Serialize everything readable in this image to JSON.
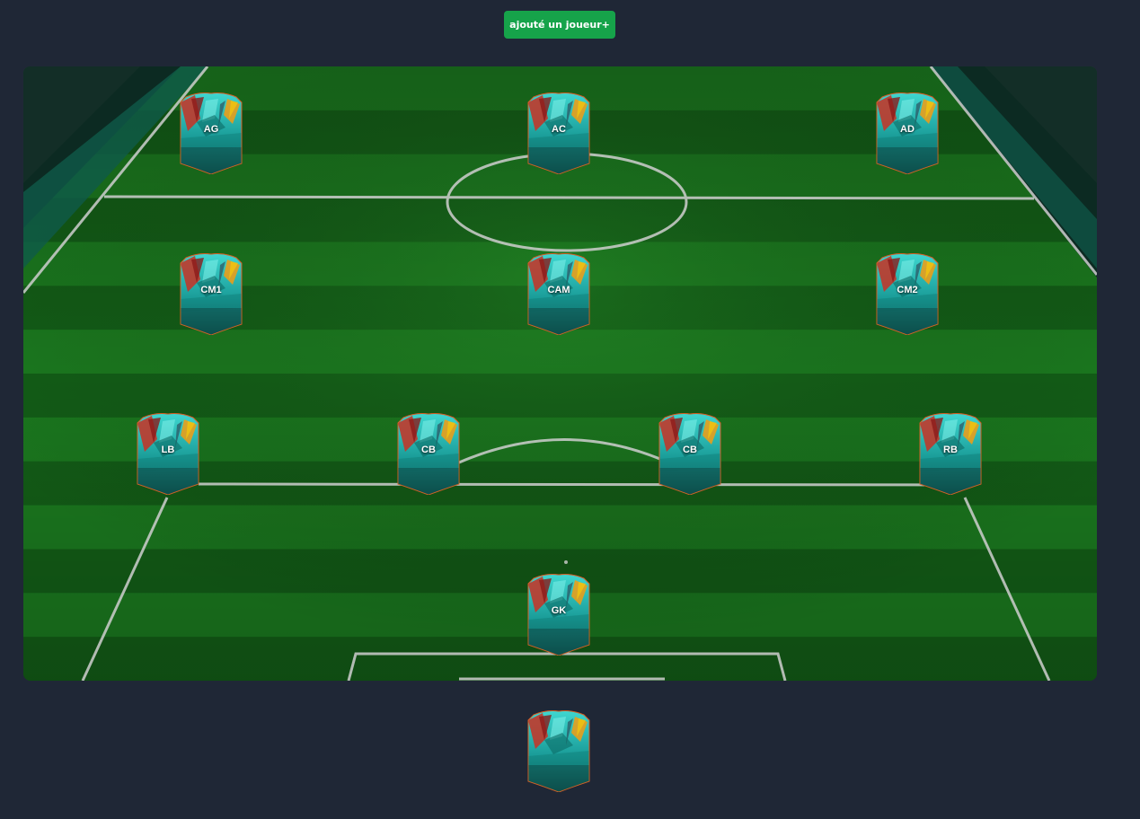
{
  "toolbar": {
    "add_player_label": "ajouté un joueur+"
  },
  "colors": {
    "page_bg": "#1f2736",
    "button_bg": "#16a34a",
    "pitch_grass_light": "#1b7a1f",
    "pitch_grass_dark": "#135e17",
    "card_teal": "#1fa7a3"
  },
  "formation": {
    "forwards": [
      {
        "pos": "AG"
      },
      {
        "pos": "AC"
      },
      {
        "pos": "AD"
      }
    ],
    "midfielders": [
      {
        "pos": "CM1"
      },
      {
        "pos": "CAM"
      },
      {
        "pos": "CM2"
      }
    ],
    "defenders": [
      {
        "pos": "LB"
      },
      {
        "pos": "CB"
      },
      {
        "pos": "CB"
      },
      {
        "pos": "RB"
      }
    ],
    "goalkeeper": {
      "pos": "GK"
    }
  },
  "bench": [
    {
      "pos": ""
    }
  ]
}
